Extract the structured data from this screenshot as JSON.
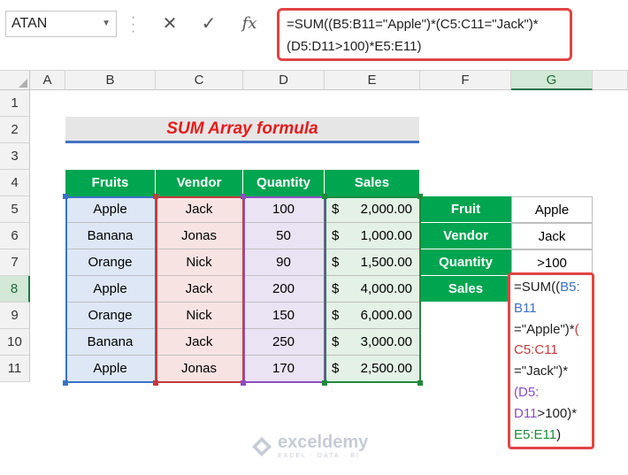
{
  "formula_bar": {
    "name_box": "ATAN",
    "cancel_icon": "✕",
    "enter_icon": "✓",
    "fx_icon": "fx",
    "formula_line1": "=SUM((B5:B11=\"Apple\")*(C5:C11=\"Jack\")*",
    "formula_line2": "(D5:D11>100)*E5:E11)"
  },
  "columns": [
    "A",
    "B",
    "C",
    "D",
    "E",
    "F",
    "G"
  ],
  "rows": [
    "1",
    "2",
    "3",
    "4",
    "5",
    "6",
    "7",
    "8",
    "9",
    "10",
    "11"
  ],
  "selected_column": "G",
  "selected_row": "8",
  "title": "SUM Array formula",
  "table": {
    "headers": [
      "Fruits",
      "Vendor",
      "Quantity",
      "Sales"
    ],
    "rows": [
      {
        "fruit": "Apple",
        "vendor": "Jack",
        "quantity": "100",
        "currency": "$",
        "sales": "2,000.00"
      },
      {
        "fruit": "Banana",
        "vendor": "Jonas",
        "quantity": "50",
        "currency": "$",
        "sales": "1,000.00"
      },
      {
        "fruit": "Orange",
        "vendor": "Nick",
        "quantity": "90",
        "currency": "$",
        "sales": "1,500.00"
      },
      {
        "fruit": "Apple",
        "vendor": "Jack",
        "quantity": "200",
        "currency": "$",
        "sales": "4,000.00"
      },
      {
        "fruit": "Orange",
        "vendor": "Nick",
        "quantity": "150",
        "currency": "$",
        "sales": "6,000.00"
      },
      {
        "fruit": "Banana",
        "vendor": "Jack",
        "quantity": "250",
        "currency": "$",
        "sales": "3,000.00"
      },
      {
        "fruit": "Apple",
        "vendor": "Jonas",
        "quantity": "170",
        "currency": "$",
        "sales": "2,500.00"
      }
    ]
  },
  "criteria": [
    {
      "label": "Fruit",
      "value": "Apple"
    },
    {
      "label": "Vendor",
      "value": "Jack"
    },
    {
      "label": "Quantity",
      "value": ">100"
    },
    {
      "label": "Sales",
      "value": ""
    }
  ],
  "cell_formula": {
    "l1": "=SUM((",
    "l1b": "B5:",
    "l2": "B11",
    "l3a": "=\"Apple\")*",
    "l3b": "(",
    "l4": "C5:C11",
    "l5": "=\"Jack\")*",
    "l6": "(D5:",
    "l7a": "D11",
    "l7b": ">100)*",
    "l8a": "E5:E11",
    "l8b": ")"
  },
  "watermark": {
    "name": "exceldemy",
    "tagline": "EXCEL · DATA · BI"
  },
  "colors": {
    "header_green": "#00a550",
    "title_red": "#e41c1c",
    "highlight_red": "#e04444",
    "range_blue": "#3a72c7",
    "range_red": "#c43b3b",
    "range_purple": "#8a4fc0",
    "range_green": "#1e8a3c"
  }
}
